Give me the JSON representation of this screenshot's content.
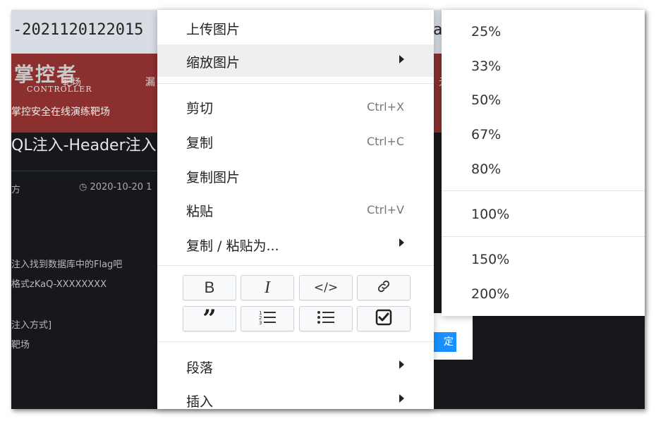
{
  "background": {
    "title_text": "-2021120122015",
    "title_right_fragment": "a",
    "logo_text": "掌控者",
    "logo_subtitle": "CONTROLLER",
    "nav_item_1": "靶场",
    "nav_item_2": "漏",
    "nav_item_3": "元",
    "banner_subtitle": "掌控安全在线演练靶场",
    "page_heading": "QL注入-Header注入",
    "author_fragment": "方",
    "date_fragment": "◷ 2020-10-20 1",
    "content_lines": [
      "注入找到数据库中的Flag吧",
      "格式zKaQ-XXXXXXXX",
      "注入方式]",
      "靶场"
    ],
    "confirm_button": "定"
  },
  "context_menu": {
    "items": [
      {
        "label": "上传图片"
      },
      {
        "label": "缩放图片",
        "has_submenu": true,
        "highlighted": true
      },
      {
        "label": "剪切",
        "shortcut": "Ctrl+X"
      },
      {
        "label": "复制",
        "shortcut": "Ctrl+C"
      },
      {
        "label": "复制图片"
      },
      {
        "label": "粘贴",
        "shortcut": "Ctrl+V"
      },
      {
        "label": "复制 / 粘贴为...",
        "has_submenu": true
      }
    ],
    "format_buttons": {
      "bold": "B",
      "italic": "I",
      "code": "</>",
      "link": "link-icon",
      "quote": "quote-icon",
      "numbered_list": "numbered-list-icon",
      "bulleted_list": "bulleted-list-icon",
      "task_list": "checkbox-icon"
    },
    "bottom_items": [
      {
        "label": "段落",
        "has_submenu": true
      },
      {
        "label": "插入",
        "has_submenu": true
      }
    ]
  },
  "zoom_submenu": {
    "options_group_1": [
      "25%",
      "33%",
      "50%",
      "67%",
      "80%"
    ],
    "options_group_2": [
      "100%"
    ],
    "options_group_3": [
      "150%",
      "200%"
    ]
  },
  "colors": {
    "highlight": "#efefef",
    "banner": "#8c2f2f",
    "confirm_button": "#1890ff"
  }
}
